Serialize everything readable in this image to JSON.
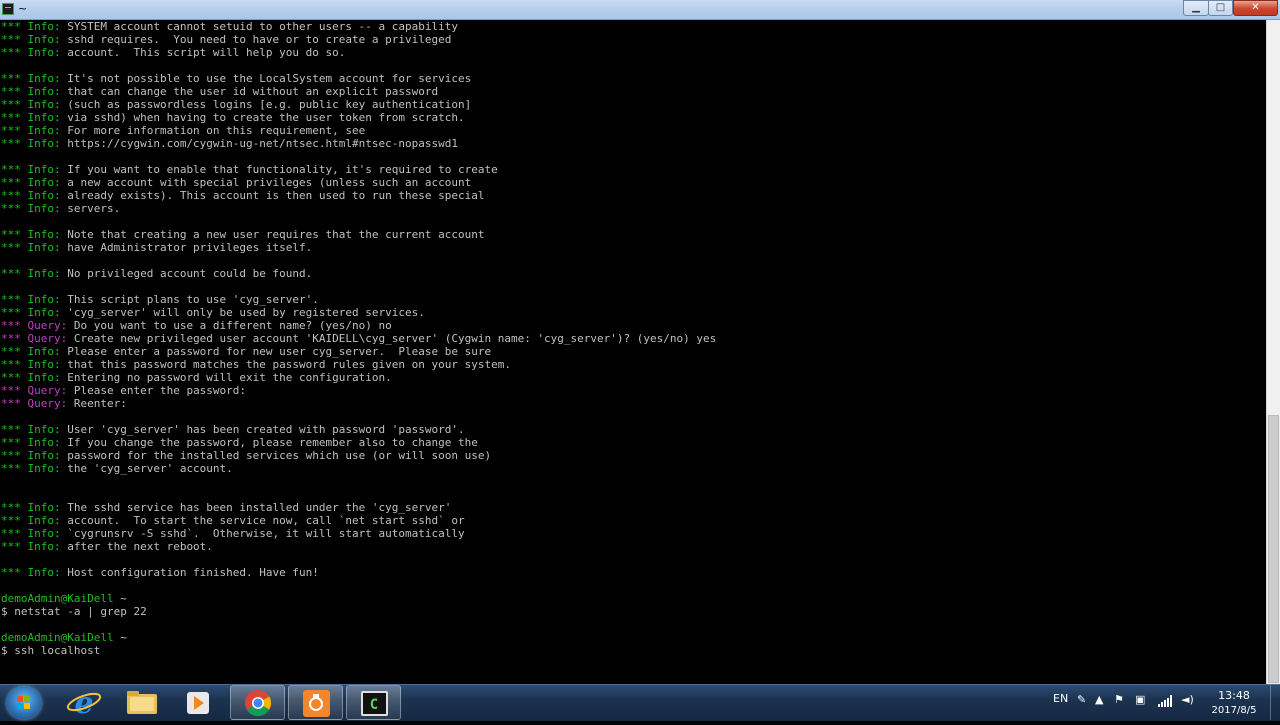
{
  "window": {
    "title": "~",
    "controls": {
      "minimize": "▁",
      "maximize": "□",
      "close": "✕"
    }
  },
  "terminal": {
    "lines": [
      {
        "prefix": "*** Info:",
        "type": "info",
        "text": " SYSTEM account cannot setuid to other users -- a capability"
      },
      {
        "prefix": "*** Info:",
        "type": "info",
        "text": " sshd requires.  You need to have or to create a privileged"
      },
      {
        "prefix": "*** Info:",
        "type": "info",
        "text": " account.  This script will help you do so."
      },
      {
        "prefix": "",
        "type": "blank",
        "text": ""
      },
      {
        "prefix": "*** Info:",
        "type": "info",
        "text": " It's not possible to use the LocalSystem account for services"
      },
      {
        "prefix": "*** Info:",
        "type": "info",
        "text": " that can change the user id without an explicit password"
      },
      {
        "prefix": "*** Info:",
        "type": "info",
        "text": " (such as passwordless logins [e.g. public key authentication]"
      },
      {
        "prefix": "*** Info:",
        "type": "info",
        "text": " via sshd) when having to create the user token from scratch."
      },
      {
        "prefix": "*** Info:",
        "type": "info",
        "text": " For more information on this requirement, see"
      },
      {
        "prefix": "*** Info:",
        "type": "info",
        "text": " https://cygwin.com/cygwin-ug-net/ntsec.html#ntsec-nopasswd1"
      },
      {
        "prefix": "",
        "type": "blank",
        "text": ""
      },
      {
        "prefix": "*** Info:",
        "type": "info",
        "text": " If you want to enable that functionality, it's required to create"
      },
      {
        "prefix": "*** Info:",
        "type": "info",
        "text": " a new account with special privileges (unless such an account"
      },
      {
        "prefix": "*** Info:",
        "type": "info",
        "text": " already exists). This account is then used to run these special"
      },
      {
        "prefix": "*** Info:",
        "type": "info",
        "text": " servers."
      },
      {
        "prefix": "",
        "type": "blank",
        "text": ""
      },
      {
        "prefix": "*** Info:",
        "type": "info",
        "text": " Note that creating a new user requires that the current account"
      },
      {
        "prefix": "*** Info:",
        "type": "info",
        "text": " have Administrator privileges itself."
      },
      {
        "prefix": "",
        "type": "blank",
        "text": ""
      },
      {
        "prefix": "*** Info:",
        "type": "info",
        "text": " No privileged account could be found."
      },
      {
        "prefix": "",
        "type": "blank",
        "text": ""
      },
      {
        "prefix": "*** Info:",
        "type": "info",
        "text": " This script plans to use 'cyg_server'."
      },
      {
        "prefix": "*** Info:",
        "type": "info",
        "text": " 'cyg_server' will only be used by registered services."
      },
      {
        "prefix": "*** Query:",
        "type": "query",
        "text": " Do you want to use a different name? (yes/no) no"
      },
      {
        "prefix": "*** Query:",
        "type": "query",
        "text": " Create new privileged user account 'KAIDELL\\cyg_server' (Cygwin name: 'cyg_server')? (yes/no) yes"
      },
      {
        "prefix": "*** Info:",
        "type": "info",
        "text": " Please enter a password for new user cyg_server.  Please be sure"
      },
      {
        "prefix": "*** Info:",
        "type": "info",
        "text": " that this password matches the password rules given on your system."
      },
      {
        "prefix": "*** Info:",
        "type": "info",
        "text": " Entering no password will exit the configuration."
      },
      {
        "prefix": "*** Query:",
        "type": "query",
        "text": " Please enter the password:"
      },
      {
        "prefix": "*** Query:",
        "type": "query",
        "text": " Reenter:"
      },
      {
        "prefix": "",
        "type": "blank",
        "text": ""
      },
      {
        "prefix": "*** Info:",
        "type": "info",
        "text": " User 'cyg_server' has been created with password 'password'."
      },
      {
        "prefix": "*** Info:",
        "type": "info",
        "text": " If you change the password, please remember also to change the"
      },
      {
        "prefix": "*** Info:",
        "type": "info",
        "text": " password for the installed services which use (or will soon use)"
      },
      {
        "prefix": "*** Info:",
        "type": "info",
        "text": " the 'cyg_server' account."
      },
      {
        "prefix": "",
        "type": "blank",
        "text": ""
      },
      {
        "prefix": "",
        "type": "blank",
        "text": ""
      },
      {
        "prefix": "*** Info:",
        "type": "info",
        "text": " The sshd service has been installed under the 'cyg_server'"
      },
      {
        "prefix": "*** Info:",
        "type": "info",
        "text": " account.  To start the service now, call `net start sshd` or"
      },
      {
        "prefix": "*** Info:",
        "type": "info",
        "text": " `cygrunsrv -S sshd`.  Otherwise, it will start automatically"
      },
      {
        "prefix": "*** Info:",
        "type": "info",
        "text": " after the next reboot."
      },
      {
        "prefix": "",
        "type": "blank",
        "text": ""
      },
      {
        "prefix": "*** Info:",
        "type": "info",
        "text": " Host configuration finished. Have fun!"
      },
      {
        "prefix": "",
        "type": "blank",
        "text": ""
      },
      {
        "prefix": "demoAdmin@KaiDell",
        "type": "prompt",
        "text": " ~"
      },
      {
        "prefix": "",
        "type": "command",
        "text": "$ netstat -a | grep 22"
      },
      {
        "prefix": "",
        "type": "blank",
        "text": ""
      },
      {
        "prefix": "demoAdmin@KaiDell",
        "type": "prompt",
        "text": " ~"
      },
      {
        "prefix": "",
        "type": "command",
        "text": "$ ssh localhost"
      }
    ]
  },
  "taskbar": {
    "apps": [
      {
        "name": "internet-explorer",
        "icon": "ie-icon",
        "active": false
      },
      {
        "name": "file-explorer",
        "icon": "folder-icon",
        "active": false
      },
      {
        "name": "media-player",
        "icon": "media-player-icon",
        "active": false
      },
      {
        "name": "chrome",
        "icon": "chrome-icon",
        "active": true
      },
      {
        "name": "orange-app",
        "icon": "orange-app-icon",
        "active": true
      },
      {
        "name": "cygwin-terminal",
        "icon": "terminal-icon",
        "active": true
      }
    ],
    "tray": {
      "language": "EN",
      "time": "13:48",
      "date": "2017/8/5"
    }
  },
  "colors": {
    "info_prefix": "#1fbf1f",
    "query_prefix": "#c33fc3",
    "terminal_bg": "#000000",
    "terminal_text": "#c0c0c0"
  }
}
